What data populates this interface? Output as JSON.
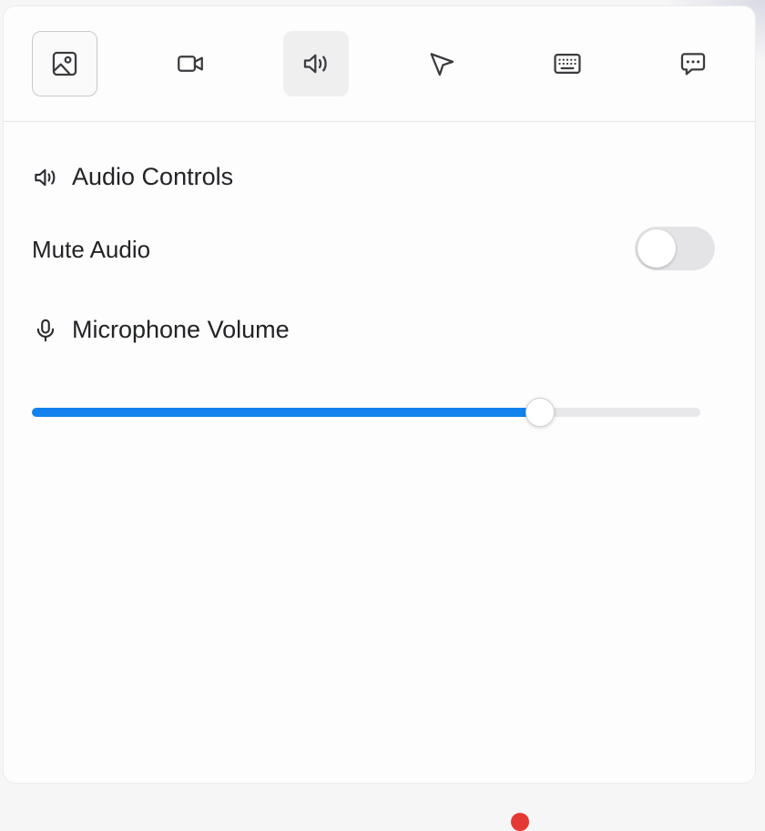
{
  "toolbar": {
    "tools": [
      {
        "name": "image",
        "icon": "image-icon",
        "state": "selected"
      },
      {
        "name": "video",
        "icon": "video-icon",
        "state": "normal"
      },
      {
        "name": "audio",
        "icon": "speaker-icon",
        "state": "active"
      },
      {
        "name": "pointer",
        "icon": "cursor-icon",
        "state": "normal"
      },
      {
        "name": "keyboard",
        "icon": "keyboard-icon",
        "state": "normal"
      },
      {
        "name": "chat",
        "icon": "chat-icon",
        "state": "normal"
      }
    ]
  },
  "audio": {
    "section_title": "Audio Controls",
    "section_icon": "speaker-icon",
    "mute_label": "Mute Audio",
    "mute_enabled": false,
    "mic_title": "Microphone Volume",
    "mic_icon": "microphone-icon",
    "mic_volume": 76
  },
  "colors": {
    "accent": "#1283ee",
    "toggle_off": "#e4e4e6",
    "text": "#222326"
  }
}
